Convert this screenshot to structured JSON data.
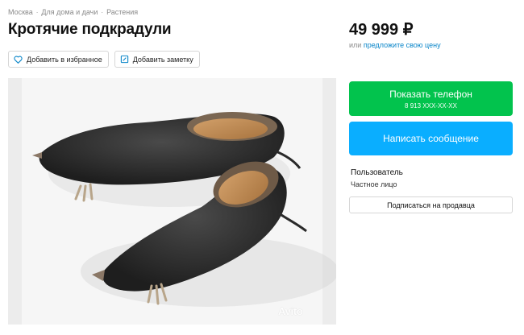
{
  "breadcrumb": {
    "items": [
      "Москва",
      "Для дома и дачи",
      "Растения"
    ],
    "separator": "·"
  },
  "listing": {
    "title": "Кротячие подкрадули"
  },
  "actions": {
    "favorite_label": "Добавить в избранное",
    "note_label": "Добавить заметку"
  },
  "price": {
    "amount": "49 999 ₽",
    "offer_prefix": "или",
    "offer_link": "предложите свою цену"
  },
  "contact": {
    "show_phone_label": "Показать телефон",
    "phone_masked": "8 913 XXX-XX-XX",
    "message_label": "Написать сообщение"
  },
  "seller": {
    "name": "Пользователь",
    "type": "Частное лицо",
    "subscribe_label": "Подписаться на продавца"
  },
  "photo": {
    "watermark": "Avito"
  },
  "colors": {
    "green": "#02c34d",
    "blue": "#0aaeff",
    "link": "#0a86c9",
    "muted": "#8a8a8a"
  },
  "icons": {
    "favorite": "heart-icon",
    "note": "note-icon"
  }
}
